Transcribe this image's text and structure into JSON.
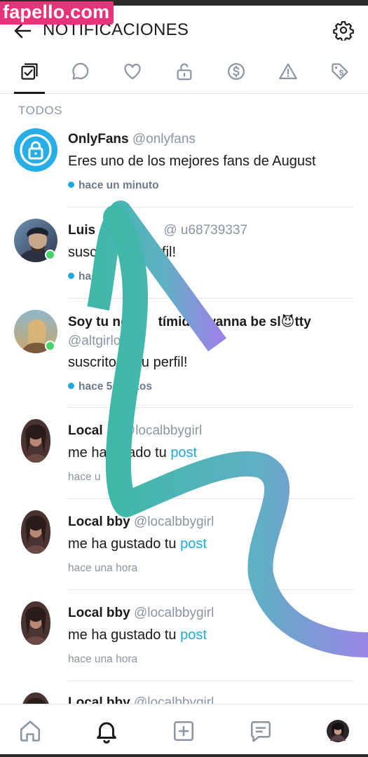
{
  "watermark": "fapello.com",
  "header": {
    "title": "NOTIFICACIONES"
  },
  "tabs": [
    {
      "icon": "checkbox-stack-icon",
      "active": true
    },
    {
      "icon": "chat-bubble-icon"
    },
    {
      "icon": "heart-icon"
    },
    {
      "icon": "unlock-icon"
    },
    {
      "icon": "dollar-coin-icon"
    },
    {
      "icon": "warning-icon"
    },
    {
      "icon": "tag-dollar-icon"
    }
  ],
  "section_label": "TODOS",
  "notifications": [
    {
      "name": "OnlyFans",
      "handle": "@onlyfans",
      "message": "Eres uno de los mejores fans de August",
      "time": "hace un minuto",
      "unread": true,
      "avatar": "onlyfans-logo"
    },
    {
      "name": "Luis",
      "handle": "@ u68739337",
      "message": "susc",
      "message_end": "perfil!",
      "time": "hace",
      "unread": true,
      "online": true
    },
    {
      "name": "Soy tu no",
      "name_mid": "tímid",
      "name_end": "wanna be sl",
      "name_tail": "tty",
      "emoji": "😈",
      "handle": "@altgirlol",
      "message": "suscrito",
      "message_end": "su perfil!",
      "time": "hace 5",
      "time_end": "utos",
      "unread": true,
      "online": true
    },
    {
      "name": "Local",
      "handle": "@localbbygirl",
      "message": "me ha",
      "message_end": "stado tu ",
      "link": "post",
      "time": "hace u",
      "unread": false
    },
    {
      "name": "Local bby",
      "handle": "@localbbygirl",
      "message": "me ha gustado tu ",
      "link": "post",
      "time": "hace una hora",
      "unread": false
    },
    {
      "name": "Local bby",
      "handle": "@localbbygirl",
      "message": "me ha gustado tu ",
      "link": "post",
      "time": "hace una hora",
      "unread": false
    },
    {
      "name": "Local bby",
      "handle": "@localbbygirl"
    }
  ],
  "bottom_nav": [
    {
      "icon": "home-icon"
    },
    {
      "icon": "bell-icon",
      "active": true
    },
    {
      "icon": "add-post-icon"
    },
    {
      "icon": "messages-icon"
    },
    {
      "icon": "profile-avatar"
    }
  ],
  "colors": {
    "accent": "#1fa8dd",
    "muted": "#8a96a3",
    "online": "#45d36a",
    "watermark": "#e8327a",
    "squiggle_a": "#3fb8a8",
    "squiggle_b": "#9a85e6"
  }
}
